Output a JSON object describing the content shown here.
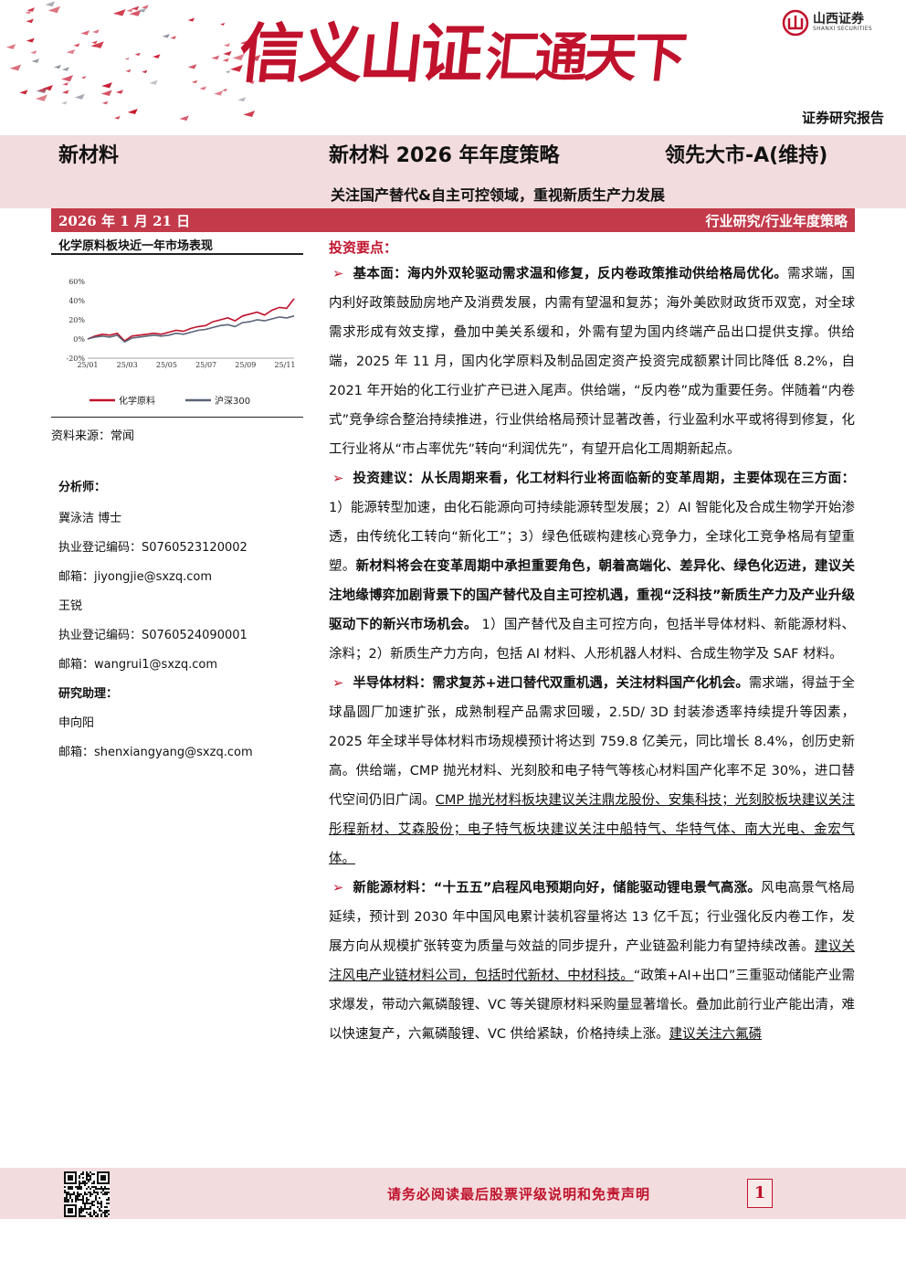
{
  "header": {
    "slogan_a": "信义山证",
    "slogan_b": "汇通天下",
    "logo_cn": "山西证券",
    "logo_en": "SHANXI SECURITIES",
    "report_type": "证券研究报告"
  },
  "title_band": {
    "industry": "新材料",
    "title": "新材料 2026 年年度策略",
    "rating": "领先大市-A(维持)",
    "subtitle": "关注国产替代&自主可控领域，重视新质生产力发展"
  },
  "date_band": {
    "date": "2026 年 1 月 21 日",
    "category": "行业研究/行业年度策略"
  },
  "chart_data": {
    "type": "line",
    "title": "化学原料板块近一年市场表现",
    "x": [
      "25/01",
      "25/03",
      "25/05",
      "25/07",
      "25/09",
      "25/11"
    ],
    "yticks": [
      "60%",
      "40%",
      "20%",
      "0%",
      "-20%"
    ],
    "ylim": [
      -20,
      60
    ],
    "series": [
      {
        "name": "化学原料",
        "color": "#c0122c",
        "values": [
          0,
          3,
          5,
          4,
          6,
          -2,
          3,
          4,
          5,
          6,
          5,
          7,
          9,
          8,
          11,
          13,
          14,
          18,
          20,
          22,
          19,
          24,
          26,
          28,
          25,
          30,
          33,
          32,
          42
        ]
      },
      {
        "name": "沪深300",
        "color": "#5a6478",
        "values": [
          0,
          2,
          3,
          2,
          4,
          -3,
          1,
          2,
          3,
          4,
          3,
          4,
          6,
          5,
          7,
          9,
          10,
          12,
          14,
          15,
          13,
          17,
          18,
          20,
          19,
          21,
          23,
          22,
          24
        ]
      }
    ],
    "source": "资料来源：常闻"
  },
  "analysts": {
    "head": "分析师：",
    "a1_name": "冀泳洁  博士",
    "a1_cert": "执业登记编码：S0760523120002",
    "a1_email": "邮箱：jiyongjie@sxzq.com",
    "a2_name": "王锐",
    "a2_cert": "执业登记编码：S0760524090001",
    "a2_email": "邮箱：wangrui1@sxzq.com",
    "assist_head": "研究助理：",
    "a3_name": "申向阳",
    "a3_email": "邮箱：shenxiangyang@sxzq.com"
  },
  "body": {
    "head": "投资要点：",
    "p1_b": "基本面：海内外双轮驱动需求温和修复，反内卷政策推动供给格局优化。",
    "p1_t": "需求端，国内利好政策鼓励房地产及消费发展，内需有望温和复苏；海外美欧财政货币双宽，对全球需求形成有效支撑，叠加中美关系缓和，外需有望为国内终端产品出口提供支撑。供给端，2025 年 11 月，国内化学原料及制品固定资产投资完成额累计同比降低 8.2%，自 2021 年开始的化工行业扩产已进入尾声。供给端，“反内卷”成为重要任务。伴随着“内卷式”竞争综合整治持续推进，行业供给格局预计显著改善，行业盈利水平或将得到修复，化工行业将从“市占率优先”转向“利润优先”，有望开启化工周期新起点。",
    "p2_b": "投资建议：从长周期来看，化工材料行业将面临新的变革周期，主要体现在三方面：",
    "p2_t1": "1）能源转型加速，由化石能源向可持续能源转型发展；2）AI 智能化及合成生物学开始渗透，由传统化工转向“新化工”；3）绿色低碳构建核心竞争力，全球化工竞争格局有望重塑。",
    "p2_b2": "新材料将会在变革周期中承担重要角色，朝着高端化、差异化、绿色化迈进，建议关注地缘博弈加剧背景下的国产替代及自主可控机遇，重视“泛科技”新质生产力及产业升级驱动下的新兴市场机会。",
    "p2_t2": " 1）国产替代及自主可控方向，包括半导体材料、新能源材料、涂料；2）新质生产力方向，包括 AI 材料、人形机器人材料、合成生物学及 SAF 材料。",
    "p3_b": "半导体材料：需求复苏+进口替代双重机遇，关注材料国产化机会。",
    "p3_t": "需求端，得益于全球晶圆厂加速扩张，成熟制程产品需求回暖，2.5D/ 3D 封装渗透率持续提升等因素，2025 年全球半导体材料市场规模预计将达到 759.8 亿美元，同比增长 8.4%，创历史新高。供给端，CMP 抛光材料、光刻胶和电子特气等核心材料国产化率不足 30%，进口替代空间仍旧广阔。",
    "p3_u": "CMP 抛光材料板块建议关注鼎龙股份、安集科技；光刻胶板块建议关注彤程新材、艾森股份；电子特气板块建议关注中船特气、华特气体、南大光电、金宏气体。",
    "p4_b": "新能源材料：“十五五”启程风电预期向好，储能驱动锂电景气高涨。",
    "p4_t1": "风电高景气格局延续，预计到 2030 年中国风电累计装机容量将达 13 亿千瓦；行业强化反内卷工作，发展方向从规模扩张转变为质量与效益的同步提升，产业链盈利能力有望持续改善。",
    "p4_u1": "建议关注风电产业链材料公司，包括时代新材、中材科技。",
    "p4_t2": "“政策+AI+出口”三重驱动储能产业需求爆发，带动六氟磷酸锂、VC 等关键原材料采购量显著增长。叠加此前行业产能出清，难以快速复产，六氟磷酸锂、VC 供给紧缺，价格持续上涨。",
    "p4_u2": "建议关注六氟磷"
  },
  "footer": {
    "disclaimer": "请务必阅读最后股票评级说明和免责声明",
    "page": "1"
  }
}
